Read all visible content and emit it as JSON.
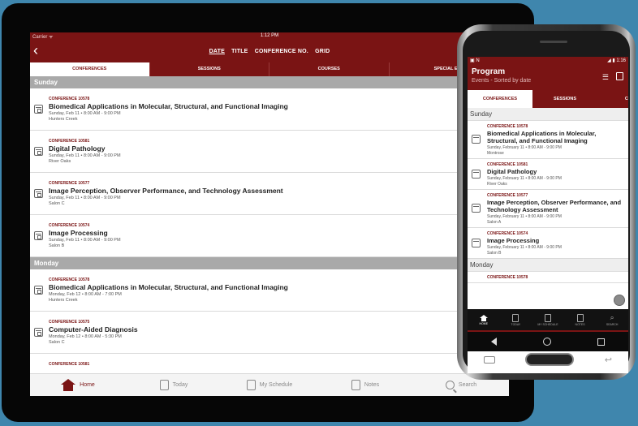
{
  "tablet": {
    "status": {
      "carrier": "Carrier ᯤ",
      "time": "1:12 PM"
    },
    "back_icon": "chevron-left-icon",
    "sort_options": [
      "DATE",
      "TITLE",
      "CONFERENCE NO.",
      "GRID"
    ],
    "tabs": [
      "CONFERENCES",
      "SESSIONS",
      "COURSES",
      "SPECIAL EVE"
    ],
    "sections": [
      {
        "day": "Sunday",
        "items": [
          {
            "code": "CONFERENCE 10578",
            "title": "Biomedical Applications in Molecular, Structural, and Functional Imaging",
            "time": "Sunday, Feb 11 • 8:00 AM - 9:00 PM",
            "room": "Hunters Creek"
          },
          {
            "code": "CONFERENCE 10581",
            "title": "Digital Pathology",
            "time": "Sunday, Feb 11 • 8:00 AM - 9:00 PM",
            "room": "River Oaks"
          },
          {
            "code": "CONFERENCE 10577",
            "title": "Image Perception, Observer Performance, and Technology Assessment",
            "time": "Sunday, Feb 11 • 8:00 AM - 9:00 PM",
            "room": "Salon C"
          },
          {
            "code": "CONFERENCE 10574",
            "title": "Image Processing",
            "time": "Sunday, Feb 11 • 8:00 AM - 9:00 PM",
            "room": "Salon B"
          }
        ]
      },
      {
        "day": "Monday",
        "items": [
          {
            "code": "CONFERENCE 10578",
            "title": "Biomedical Applications in Molecular, Structural, and Functional Imaging",
            "time": "Monday, Feb 12 • 8:00 AM - 7:00 PM",
            "room": "Hunters Creek"
          },
          {
            "code": "CONFERENCE 10575",
            "title": "Computer-Aided Diagnosis",
            "time": "Monday, Feb 12 • 8:00 AM - 5:30 PM",
            "room": "Salon C"
          },
          {
            "code": "CONFERENCE 10581",
            "title": "",
            "time": "",
            "room": ""
          }
        ]
      }
    ],
    "bottom_nav": [
      "Home",
      "Today",
      "My Schedule",
      "Notes",
      "Search"
    ]
  },
  "phone": {
    "status": {
      "left": "▣ N",
      "right": "◢ ▮ 1:16"
    },
    "title": "Program",
    "subtitle": "Events - Sorted by date",
    "tabs": [
      "CONFERENCES",
      "SESSIONS",
      "COU"
    ],
    "sections": [
      {
        "day": "Sunday",
        "items": [
          {
            "code": "CONFERENCE 10578",
            "title": "Biomedical Applications in Molecular, Structural, and Functional Imaging",
            "time": "Sunday, February 11 • 8:00 AM - 9:00 PM",
            "room": "Montrose"
          },
          {
            "code": "CONFERENCE 10581",
            "title": "Digital Pathology",
            "time": "Sunday, February 11 • 8:00 AM - 9:00 PM",
            "room": "River Oaks"
          },
          {
            "code": "CONFERENCE 10577",
            "title": "Image Perception, Observer Performance, and Technology Assessment",
            "time": "Sunday, February 11 • 8:00 AM - 9:00 PM",
            "room": "Salon A"
          },
          {
            "code": "CONFERENCE 10574",
            "title": "Image Processing",
            "time": "Sunday, February 11 • 8:00 AM - 9:00 PM",
            "room": "Salon B"
          }
        ]
      },
      {
        "day": "Monday",
        "items": [
          {
            "code": "CONFERENCE 10578",
            "title": "",
            "time": "",
            "room": ""
          }
        ]
      }
    ],
    "bottom_nav": [
      "HOME",
      "TODAY",
      "MY SCHEDULE",
      "NOTES",
      "SEARCH"
    ]
  },
  "colors": {
    "brand": "#7a1414",
    "background": "#3f86ad",
    "day_header": "#a9a9a9"
  }
}
